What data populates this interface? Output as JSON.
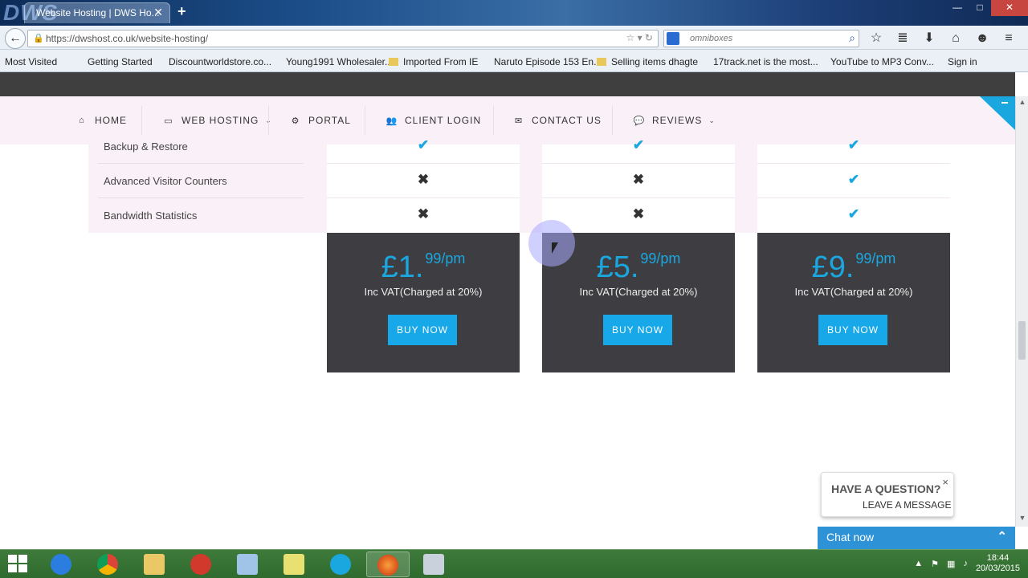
{
  "browser": {
    "tab_title": "Website Hosting | DWS Ho...",
    "tab_close": "✕",
    "new_tab": "+",
    "logo_text": "DWS",
    "url": "https://dwshost.co.uk/website-hosting/",
    "search_placeholder": "omniboxes",
    "window_buttons": [
      "—",
      "□",
      "✕"
    ]
  },
  "bookmarks": [
    {
      "label": "Most Visited"
    },
    {
      "label": "Getting Started"
    },
    {
      "label": "Discountworldstore.co..."
    },
    {
      "label": "Young1991 Wholesaler..."
    },
    {
      "label": "Imported From IE"
    },
    {
      "label": "Naruto Episode 153 En..."
    },
    {
      "label": "Selling items dhagte"
    },
    {
      "label": "17track.net is the most..."
    },
    {
      "label": "YouTube to MP3 Conv..."
    },
    {
      "label": "Sign in"
    }
  ],
  "menu": {
    "home": "HOME",
    "web_hosting": "WEB HOSTING",
    "portal": "PORTAL",
    "client_login": "CLIENT LOGIN",
    "contact_us": "CONTACT US",
    "reviews": "REVIEWS"
  },
  "features": [
    {
      "label": "Backup & Restore",
      "plans": [
        true,
        true,
        true
      ]
    },
    {
      "label": "Advanced Visitor Counters",
      "plans": [
        false,
        false,
        true
      ]
    },
    {
      "label": "Bandwidth Statistics",
      "plans": [
        false,
        false,
        true
      ]
    }
  ],
  "plans": [
    {
      "price_int": "£1.",
      "price_sup": "99/pm",
      "note": "Inc VAT(Charged at 20%)",
      "button": "BUY NOW"
    },
    {
      "price_int": "£5.",
      "price_sup": "99/pm",
      "note": "Inc VAT(Charged at 20%)",
      "button": "BUY NOW"
    },
    {
      "price_int": "£9.",
      "price_sup": "99/pm",
      "note": "Inc VAT(Charged at 20%)",
      "button": "BUY NOW"
    }
  ],
  "chat": {
    "question_title": "HAVE A QUESTION?",
    "question_sub": "LEAVE A MESSAGE",
    "close": "×",
    "chat_now": "Chat now"
  },
  "taskbar": {
    "time": "18:44",
    "date": "20/03/2015"
  },
  "colors": {
    "accent": "#1aa7e0",
    "price_box": "#3e3e42",
    "menu_bg": "#faf0f8"
  }
}
